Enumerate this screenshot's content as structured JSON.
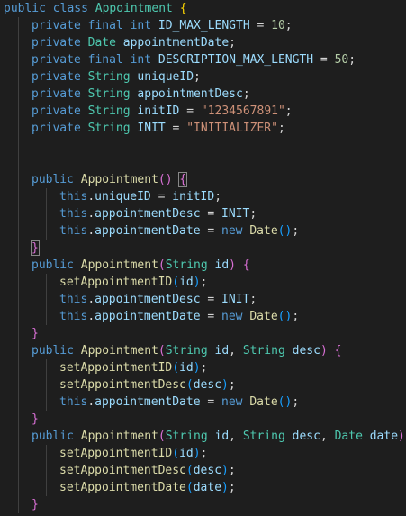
{
  "colors": {
    "background": "#1e1e1e",
    "keyword": "#569cd6",
    "type": "#4ec9b0",
    "function": "#dcdcaa",
    "variable": "#9cdcfe",
    "number": "#b5cea8",
    "string": "#ce9178",
    "plain": "#d4d4d4",
    "bracket_level1": "#ffd700",
    "bracket_level2": "#da70d6",
    "bracket_level3": "#179fff"
  },
  "lines": [
    {
      "indent": 0,
      "tokens": [
        [
          "kw",
          "public"
        ],
        [
          "op",
          " "
        ],
        [
          "kw",
          "class"
        ],
        [
          "op",
          " "
        ],
        [
          "ty",
          "Appointment"
        ],
        [
          "op",
          " "
        ],
        [
          "b1",
          "{"
        ]
      ]
    },
    {
      "indent": 1,
      "tokens": [
        [
          "kw",
          "private"
        ],
        [
          "op",
          " "
        ],
        [
          "kw",
          "final"
        ],
        [
          "op",
          " "
        ],
        [
          "kw",
          "int"
        ],
        [
          "op",
          " "
        ],
        [
          "va",
          "ID_MAX_LENGTH"
        ],
        [
          "op",
          " = "
        ],
        [
          "nu",
          "10"
        ],
        [
          "op",
          ";"
        ]
      ]
    },
    {
      "indent": 1,
      "tokens": [
        [
          "kw",
          "private"
        ],
        [
          "op",
          " "
        ],
        [
          "ty",
          "Date"
        ],
        [
          "op",
          " "
        ],
        [
          "va",
          "appointmentDate"
        ],
        [
          "op",
          ";"
        ]
      ]
    },
    {
      "indent": 1,
      "tokens": [
        [
          "kw",
          "private"
        ],
        [
          "op",
          " "
        ],
        [
          "kw",
          "final"
        ],
        [
          "op",
          " "
        ],
        [
          "kw",
          "int"
        ],
        [
          "op",
          " "
        ],
        [
          "va",
          "DESCRIPTION_MAX_LENGTH"
        ],
        [
          "op",
          " = "
        ],
        [
          "nu",
          "50"
        ],
        [
          "op",
          ";"
        ]
      ]
    },
    {
      "indent": 1,
      "tokens": [
        [
          "kw",
          "private"
        ],
        [
          "op",
          " "
        ],
        [
          "ty",
          "String"
        ],
        [
          "op",
          " "
        ],
        [
          "va",
          "uniqueID"
        ],
        [
          "op",
          ";"
        ]
      ]
    },
    {
      "indent": 1,
      "tokens": [
        [
          "kw",
          "private"
        ],
        [
          "op",
          " "
        ],
        [
          "ty",
          "String"
        ],
        [
          "op",
          " "
        ],
        [
          "va",
          "appointmentDesc"
        ],
        [
          "op",
          ";"
        ]
      ]
    },
    {
      "indent": 1,
      "tokens": [
        [
          "kw",
          "private"
        ],
        [
          "op",
          " "
        ],
        [
          "ty",
          "String"
        ],
        [
          "op",
          " "
        ],
        [
          "va",
          "initID"
        ],
        [
          "op",
          " = "
        ],
        [
          "st",
          "\"1234567891\""
        ],
        [
          "op",
          ";"
        ]
      ]
    },
    {
      "indent": 1,
      "tokens": [
        [
          "kw",
          "private"
        ],
        [
          "op",
          " "
        ],
        [
          "ty",
          "String"
        ],
        [
          "op",
          " "
        ],
        [
          "va",
          "INIT"
        ],
        [
          "op",
          " = "
        ],
        [
          "st",
          "\"INITIALIZER\""
        ],
        [
          "op",
          ";"
        ]
      ]
    },
    {
      "indent": 0,
      "tokens": []
    },
    {
      "indent": 0,
      "tokens": []
    },
    {
      "indent": 1,
      "tokens": [
        [
          "kw",
          "public"
        ],
        [
          "op",
          " "
        ],
        [
          "fn",
          "Appointment"
        ],
        [
          "b2",
          "()"
        ],
        [
          "op",
          " "
        ],
        [
          "b2 bm",
          "{"
        ]
      ]
    },
    {
      "indent": 2,
      "tokens": [
        [
          "kw",
          "this"
        ],
        [
          "op",
          "."
        ],
        [
          "va",
          "uniqueID"
        ],
        [
          "op",
          " = "
        ],
        [
          "va",
          "initID"
        ],
        [
          "op",
          ";"
        ]
      ]
    },
    {
      "indent": 2,
      "tokens": [
        [
          "kw",
          "this"
        ],
        [
          "op",
          "."
        ],
        [
          "va",
          "appointmentDesc"
        ],
        [
          "op",
          " = "
        ],
        [
          "va",
          "INIT"
        ],
        [
          "op",
          ";"
        ]
      ]
    },
    {
      "indent": 2,
      "tokens": [
        [
          "kw",
          "this"
        ],
        [
          "op",
          "."
        ],
        [
          "va",
          "appointmentDate"
        ],
        [
          "op",
          " = "
        ],
        [
          "kw",
          "new"
        ],
        [
          "op",
          " "
        ],
        [
          "fn",
          "Date"
        ],
        [
          "b3",
          "()"
        ],
        [
          "op",
          ";"
        ]
      ]
    },
    {
      "indent": 1,
      "tokens": [
        [
          "b2 bm",
          "}"
        ]
      ]
    },
    {
      "indent": 1,
      "tokens": [
        [
          "kw",
          "public"
        ],
        [
          "op",
          " "
        ],
        [
          "fn",
          "Appointment"
        ],
        [
          "b2",
          "("
        ],
        [
          "ty",
          "String"
        ],
        [
          "op",
          " "
        ],
        [
          "va",
          "id"
        ],
        [
          "b2",
          ")"
        ],
        [
          "op",
          " "
        ],
        [
          "b2",
          "{"
        ]
      ]
    },
    {
      "indent": 2,
      "tokens": [
        [
          "fn",
          "setAppointmentID"
        ],
        [
          "b3",
          "("
        ],
        [
          "va",
          "id"
        ],
        [
          "b3",
          ")"
        ],
        [
          "op",
          ";"
        ]
      ]
    },
    {
      "indent": 2,
      "tokens": [
        [
          "kw",
          "this"
        ],
        [
          "op",
          "."
        ],
        [
          "va",
          "appointmentDesc"
        ],
        [
          "op",
          " = "
        ],
        [
          "va",
          "INIT"
        ],
        [
          "op",
          ";"
        ]
      ]
    },
    {
      "indent": 2,
      "tokens": [
        [
          "kw",
          "this"
        ],
        [
          "op",
          "."
        ],
        [
          "va",
          "appointmentDate"
        ],
        [
          "op",
          " = "
        ],
        [
          "kw",
          "new"
        ],
        [
          "op",
          " "
        ],
        [
          "fn",
          "Date"
        ],
        [
          "b3",
          "()"
        ],
        [
          "op",
          ";"
        ]
      ]
    },
    {
      "indent": 1,
      "tokens": [
        [
          "b2",
          "}"
        ]
      ]
    },
    {
      "indent": 1,
      "tokens": [
        [
          "kw",
          "public"
        ],
        [
          "op",
          " "
        ],
        [
          "fn",
          "Appointment"
        ],
        [
          "b2",
          "("
        ],
        [
          "ty",
          "String"
        ],
        [
          "op",
          " "
        ],
        [
          "va",
          "id"
        ],
        [
          "op",
          ", "
        ],
        [
          "ty",
          "String"
        ],
        [
          "op",
          " "
        ],
        [
          "va",
          "desc"
        ],
        [
          "b2",
          ")"
        ],
        [
          "op",
          " "
        ],
        [
          "b2",
          "{"
        ]
      ]
    },
    {
      "indent": 2,
      "tokens": [
        [
          "fn",
          "setAppointmentID"
        ],
        [
          "b3",
          "("
        ],
        [
          "va",
          "id"
        ],
        [
          "b3",
          ")"
        ],
        [
          "op",
          ";"
        ]
      ]
    },
    {
      "indent": 2,
      "tokens": [
        [
          "fn",
          "setAppointmentDesc"
        ],
        [
          "b3",
          "("
        ],
        [
          "va",
          "desc"
        ],
        [
          "b3",
          ")"
        ],
        [
          "op",
          ";"
        ]
      ]
    },
    {
      "indent": 2,
      "tokens": [
        [
          "kw",
          "this"
        ],
        [
          "op",
          "."
        ],
        [
          "va",
          "appointmentDate"
        ],
        [
          "op",
          " = "
        ],
        [
          "kw",
          "new"
        ],
        [
          "op",
          " "
        ],
        [
          "fn",
          "Date"
        ],
        [
          "b3",
          "()"
        ],
        [
          "op",
          ";"
        ]
      ]
    },
    {
      "indent": 1,
      "tokens": [
        [
          "b2",
          "}"
        ]
      ]
    },
    {
      "indent": 1,
      "tokens": [
        [
          "kw",
          "public"
        ],
        [
          "op",
          " "
        ],
        [
          "fn",
          "Appointment"
        ],
        [
          "b2",
          "("
        ],
        [
          "ty",
          "String"
        ],
        [
          "op",
          " "
        ],
        [
          "va",
          "id"
        ],
        [
          "op",
          ", "
        ],
        [
          "ty",
          "String"
        ],
        [
          "op",
          " "
        ],
        [
          "va",
          "desc"
        ],
        [
          "op",
          ", "
        ],
        [
          "ty",
          "Date"
        ],
        [
          "op",
          " "
        ],
        [
          "va",
          "date"
        ],
        [
          "b2",
          ")"
        ]
      ]
    },
    {
      "indent": 2,
      "tokens": [
        [
          "fn",
          "setAppointmentID"
        ],
        [
          "b3",
          "("
        ],
        [
          "va",
          "id"
        ],
        [
          "b3",
          ")"
        ],
        [
          "op",
          ";"
        ]
      ]
    },
    {
      "indent": 2,
      "tokens": [
        [
          "fn",
          "setAppointmentDesc"
        ],
        [
          "b3",
          "("
        ],
        [
          "va",
          "desc"
        ],
        [
          "b3",
          ")"
        ],
        [
          "op",
          ";"
        ]
      ]
    },
    {
      "indent": 2,
      "tokens": [
        [
          "fn",
          "setAppointmentDate"
        ],
        [
          "b3",
          "("
        ],
        [
          "va",
          "date"
        ],
        [
          "b3",
          ")"
        ],
        [
          "op",
          ";"
        ]
      ]
    },
    {
      "indent": 1,
      "tokens": [
        [
          "b2",
          "}"
        ]
      ]
    }
  ]
}
